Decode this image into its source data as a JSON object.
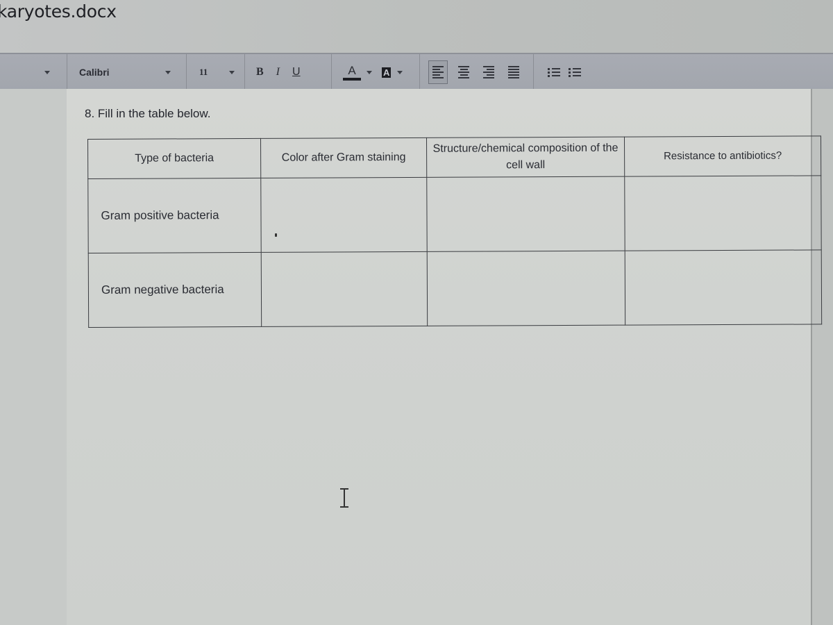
{
  "window": {
    "title": "karyotes.docx"
  },
  "toolbar": {
    "style_dropdown_value": "",
    "font_name": "Calibri",
    "font_size": "11",
    "bold_label": "B",
    "italic_label": "I",
    "underline_label": "U",
    "font_color_label": "A",
    "highlight_label": "A",
    "align_options": [
      "align-left",
      "align-center",
      "align-right",
      "justify"
    ],
    "active_alignment": "align-left",
    "list_options": [
      "numbered-list",
      "bulleted-list"
    ]
  },
  "document": {
    "instruction": "8. Fill in the table below.",
    "table": {
      "headers": [
        "Type of bacteria",
        "Color after Gram staining",
        "Structure/chemical composition of the cell wall",
        "Resistance to antibiotics?"
      ],
      "rows": [
        [
          "Gram positive bacteria",
          "",
          "",
          ""
        ],
        [
          "Gram negative bacteria",
          "",
          "",
          ""
        ]
      ]
    }
  }
}
